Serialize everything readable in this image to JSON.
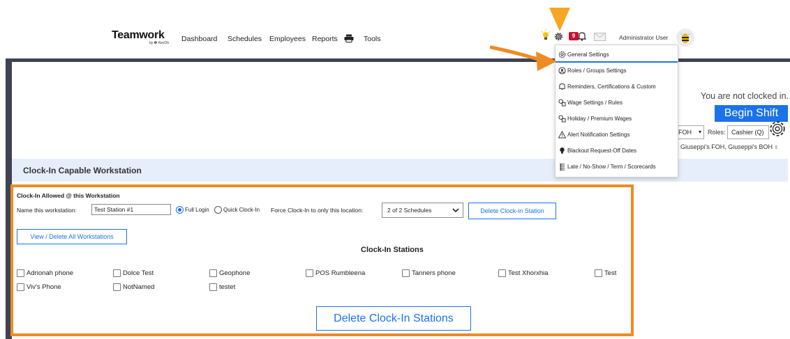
{
  "header": {
    "logo": "Teamwork",
    "logo_sub": "by ❷ RevOh",
    "nav": [
      "Dashboard",
      "Schedules",
      "Employees",
      "Reports",
      "Tools"
    ],
    "badge_count": "9",
    "user_name": "Administrator User"
  },
  "settings_menu": {
    "items": [
      {
        "label": "General Settings",
        "icon": "gear-icon"
      },
      {
        "label": "Roles / Groups Settings",
        "icon": "roles-icon"
      },
      {
        "label": "Reminders, Certifications & Custom",
        "icon": "bell-icon"
      },
      {
        "label": "Wage Settings / Rules",
        "icon": "wage-icon"
      },
      {
        "label": "Holiday / Premium Wages",
        "icon": "holiday-icon"
      },
      {
        "label": "Alert Notification Settings",
        "icon": "warning-icon"
      },
      {
        "label": "Blackout Request-Off Dates",
        "icon": "bulb-icon"
      },
      {
        "label": "Late / No-Show / Term / Scorecards",
        "icon": "scorecard-icon"
      }
    ]
  },
  "clock": {
    "status": "You are not clocked in.",
    "begin_label": "Begin Shift",
    "location_value": "FOH",
    "roles_label": "Roles:",
    "roles_value": "Cashier (Q)",
    "locations_text": "c Giuseppi's FOH, Giuseppi's BOH"
  },
  "section": {
    "title": "Clock-In Capable Workstation"
  },
  "workstation": {
    "allowed_label": "Clock-In Allowed @ this Workstation",
    "name_label": "Name this workstation:",
    "name_value": "Test Station #1",
    "full_login": "Full Login",
    "quick_clock": "Quick Clock-In",
    "force_label": "Force Clock-In to only this location:",
    "schedule_value": "2 of 2 Schedules",
    "delete_station": "Delete Clock-in Station",
    "view_all": "View / Delete All Workstations",
    "stations_title": "Clock-In Stations",
    "stations": [
      "Adrionah phone",
      "Dolce Test",
      "Geophone",
      "POS Rumbleena",
      "Tanners phone",
      "Test Xhorxhia",
      "Test",
      "Viv's Phone",
      "NotNamed",
      "testet"
    ],
    "delete_stations": "Delete Clock-In Stations"
  },
  "colors": {
    "accent": "#1a73e8",
    "highlight": "#f08a24",
    "frame": "#3f4252",
    "section_bg": "#e6eefb"
  }
}
